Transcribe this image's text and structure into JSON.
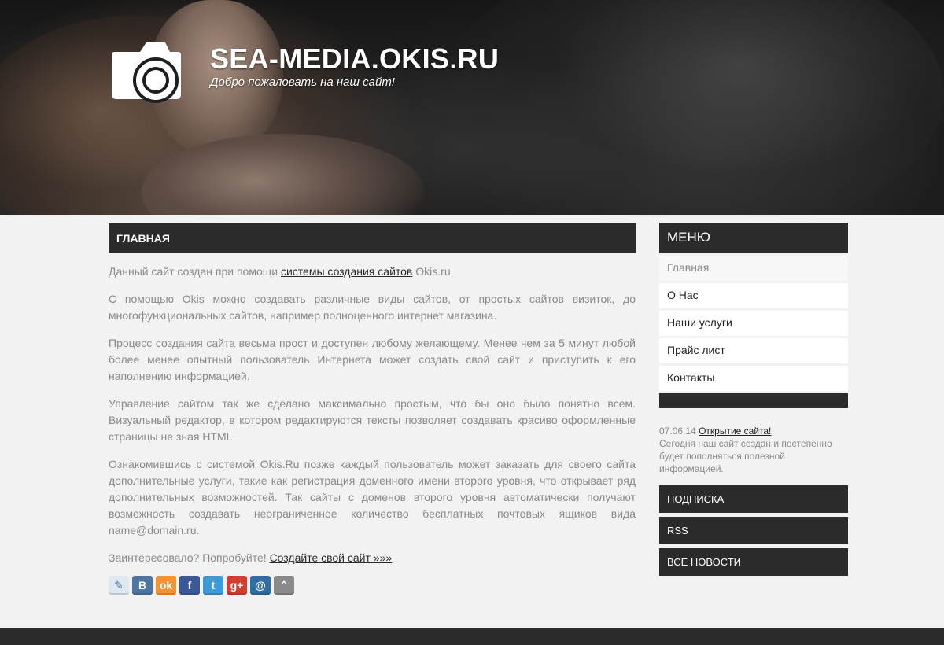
{
  "header": {
    "site_title": "SEA-MEDIA.OKIS.RU",
    "subtitle": "Добро пожаловать на наш сайт!"
  },
  "main": {
    "heading": "ГЛАВНАЯ",
    "p1_text": "Данный сайт создан при помощи ",
    "p1_link": "системы создания сайтов",
    "p1_tail": " Okis.ru",
    "p2": "С помощью Okis можно создавать различные виды сайтов, от простых сайтов визиток, до многофункциональных сайтов, например полноценного интернет магазина.",
    "p3": "Процесс создания сайта весьма прост и доступен любому желающему. Менее чем за 5 минут любой более менее опытный пользователь Интернета может создать свой сайт и приступить к его наполнению информацией.",
    "p4": "Управление сайтом так же сделано максимально простым, что бы оно было понятно всем. Визуальный редактор, в котором редактируются тексты позволяет создавать красиво оформленные страницы не зная HTML.",
    "p5": "Ознакомившись с системой Okis.Ru позже каждый пользователь может заказать для своего сайта дополнительные услуги, такие как регистрация доменного имени второго уровня, что открывает ряд дополнительных возможностей. Так сайты с доменов второго уровня автоматически получают возможность создавать неограниченное количество бесплатных почтовых ящиков вида name@domain.ru.",
    "p6_text": "Заинтересовало? Попробуйте! ",
    "p6_link": "Создайте свой сайт »»»",
    "share_icons": [
      {
        "name": "livejournal-icon",
        "glyph": "✎",
        "color": "#dfe8f0"
      },
      {
        "name": "vkontakte-icon",
        "glyph": "B",
        "color": "#4c75a3"
      },
      {
        "name": "odnoklassniki-icon",
        "glyph": "ok",
        "color": "#f59330"
      },
      {
        "name": "facebook-icon",
        "glyph": "f",
        "color": "#3b5998"
      },
      {
        "name": "twitter-icon",
        "glyph": "t",
        "color": "#3a9bd8"
      },
      {
        "name": "googleplus-icon",
        "glyph": "g+",
        "color": "#d23f2f"
      },
      {
        "name": "mailru-icon",
        "glyph": "@",
        "color": "#2f6ea5"
      },
      {
        "name": "more-share-icon",
        "glyph": "⌃",
        "color": "#8a8a8a"
      }
    ]
  },
  "sidebar": {
    "menu_title": "МЕНЮ",
    "menu_items": [
      {
        "label": "Главная"
      },
      {
        "label": "О Нас"
      },
      {
        "label": "Наши услуги"
      },
      {
        "label": "Прайс лист"
      },
      {
        "label": "Контакты"
      }
    ],
    "news": {
      "date": "07.06.14",
      "title": "Открытие сайта!",
      "text": "Сегодня наш сайт создан и постепенно будет пополняться полезной информацией."
    },
    "boxes": [
      {
        "label": "ПОДПИСКА"
      },
      {
        "label": "RSS"
      },
      {
        "label": "ВСЕ НОВОСТИ"
      }
    ]
  }
}
